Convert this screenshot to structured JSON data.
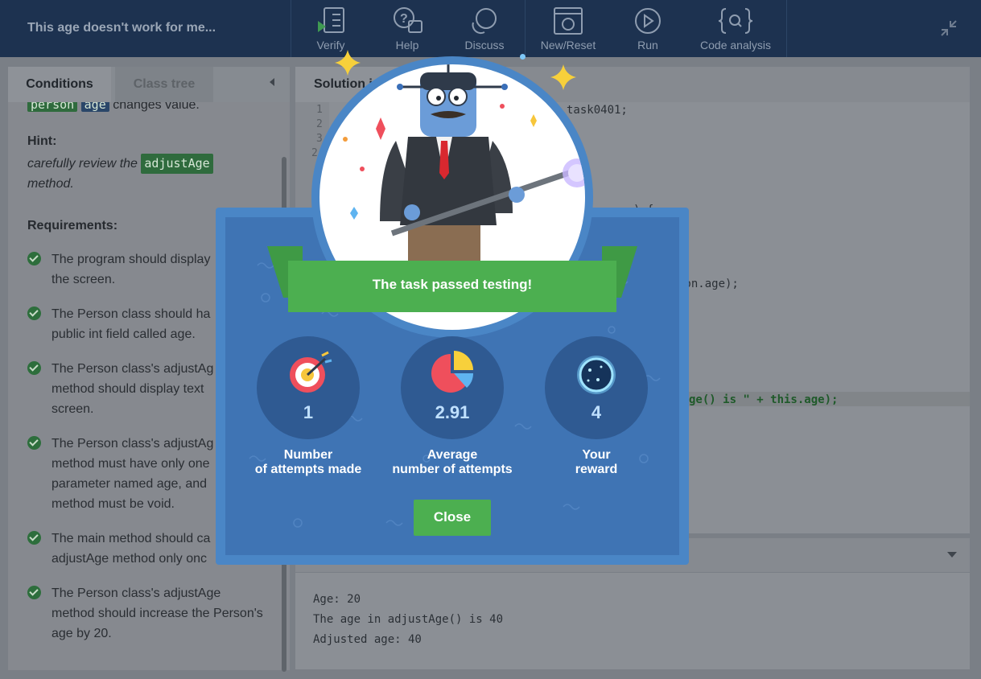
{
  "header": {
    "task_title": "This age doesn't work for me...",
    "buttons": [
      {
        "label": "Verify",
        "icon": "checklist-play-icon"
      },
      {
        "label": "Help",
        "icon": "help-chat-icon"
      },
      {
        "label": "Discuss",
        "icon": "discuss-bubbles-icon"
      },
      {
        "label": "New/Reset",
        "icon": "reset-icon"
      },
      {
        "label": "Run",
        "icon": "play-circle-icon"
      },
      {
        "label": "Code analysis",
        "icon": "code-analysis-icon"
      }
    ]
  },
  "left_panel": {
    "tabs": [
      "Conditions",
      "Class tree"
    ],
    "intro_chips": [
      "person",
      "age"
    ],
    "intro_text": "changes value.",
    "hint_title": "Hint:",
    "hint_text_before": "carefully review the",
    "hint_chip": "adjustAge",
    "hint_text_after": "method.",
    "requirements_title": "Requirements:",
    "requirements": [
      {
        "line1": "The program should display",
        "line2": "the screen."
      },
      {
        "line1": "The Person class should ha",
        "line2": "public int field called age."
      },
      {
        "line1": "The Person class's adjustAg",
        "line2": "method should display text",
        "line3": "screen."
      },
      {
        "line1": "The Person class's adjustAg",
        "line2": "method must have only one",
        "line3": "parameter named age, and",
        "line4": "method must be void."
      },
      {
        "line1": "The main method should ca",
        "line2": "adjustAge method only onc"
      },
      {
        "line1": "The Person class's adjustAge",
        "line2": "method should increase the Person's",
        "line3": "age by 20."
      }
    ]
  },
  "editor": {
    "tab": "Solution.ja",
    "line_numbers": [
      "1",
      "2",
      "3",
      "2"
    ],
    "code_fragments": {
      "package_tail": "task0401;",
      "brace_tail": ") {",
      "person_age": "son.age);",
      "highlight_line": "ge() is \" + this.age);"
    }
  },
  "output": {
    "lines": [
      "Age: 20",
      "The age in adjustAge() is 40",
      "Adjusted age: 40"
    ]
  },
  "modal": {
    "banner": "The task passed testing!",
    "stats": [
      {
        "value": "1",
        "label1": "Number",
        "label2": "of attempts made"
      },
      {
        "value": "2.91",
        "label1": "Average",
        "label2": "number of attempts"
      },
      {
        "value": "4",
        "label1": "Your",
        "label2": "reward"
      }
    ],
    "close_label": "Close"
  }
}
